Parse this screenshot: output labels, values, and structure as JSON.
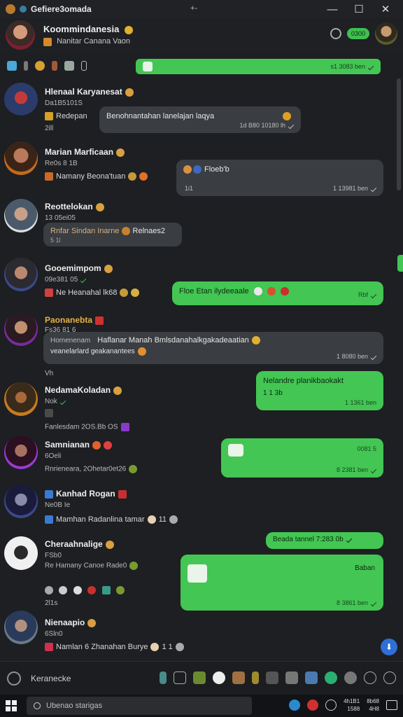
{
  "window": {
    "title": "Gefiere3omada",
    "center_glyph": "+-",
    "minimize": "—",
    "maximize": "☐",
    "close": "✕"
  },
  "header": {
    "name": "Koommindanesia",
    "subtitle": "Nanitar Canana Vaon",
    "pill": "0300"
  },
  "toolbar": {
    "banner_meta": "s1 3083 ben"
  },
  "messages": [
    {
      "name": "Hlenaal Karyanesat",
      "line1": "Da1B5101S",
      "line2": "Redepan",
      "line3": "2ill",
      "bubble": "Benohnantahan lanelajan laqya",
      "meta": "1d B80 10180 lh",
      "kind": "grey"
    },
    {
      "name": "Marian Marficaan",
      "line1": "Re0s 8 1B",
      "line2": "Namany Beona'tuan",
      "bubble": "Floeb'b",
      "meta": "1 13981 ben",
      "kind": "grey-right",
      "bubble_meta_left": "1i1"
    },
    {
      "name": "Reottelokan",
      "line1": "13 05ei05",
      "bubble": "Rnfar Sindan Inarne",
      "bubble_extra": "Relnaes2",
      "bubble_sub": "5 1l",
      "kind": "grey-left"
    },
    {
      "name": "Gooemimpom",
      "line1": "09e381 05",
      "line2": "Ne Heanahal lk68",
      "bubble": "Floe Etan ilydeeaale",
      "meta": "Rbf",
      "kind": "green"
    },
    {
      "name": "Paonanebta",
      "line1": "Fs36 81 6",
      "line2": "Homenenam",
      "bubble": "Haflanar Manah Bmlsdanahalkgakadeaatian",
      "bubble_sub": "veanelarlard geakanantees",
      "meta": "1 8080 ben",
      "line3": "Vh",
      "kind": "grey-wide"
    },
    {
      "name": "NedamaKoladan",
      "line1": "Nok",
      "line2": "Fanlesdam 2OS.Bb OS",
      "bubble": "Nelandre planikbaokakt",
      "bubble_sub": "1 1 3b",
      "meta": "1 1361 ben",
      "kind": "green"
    },
    {
      "name": "Samnianan",
      "line1": "6Oeli",
      "line2": "Rnrieneara, 2Ohetar0et26",
      "meta": "8 2381 ben",
      "meta_top": "0081 5",
      "kind": "green-media"
    },
    {
      "name": "Kanhad Rogan",
      "line1": "Ne0B Ie",
      "line2": "Mamhan Radanlina tamar",
      "line2_extra": "11",
      "kind": "none"
    },
    {
      "name": "Cheraahnalige",
      "line1": "FSb0",
      "line2": "Re Hamany Canoe Rade0",
      "line3": "2l1s",
      "bubble": "Beada tannel 7:283 0b",
      "meta": "8 3861 ben",
      "media_label": "Baban",
      "kind": "green-stack"
    },
    {
      "name": "Nienaapio",
      "line1": "6Sln0",
      "line2": "Namlan 6 Zhanahan Burye",
      "line2_extra": "1 1",
      "kind": "none"
    }
  ],
  "composer": {
    "placeholder": "Keranecke"
  },
  "taskbar": {
    "search": "Ubenao starigas",
    "time": "4h1B1",
    "date": "1588",
    "time2": "8b68",
    "date2": "4H8"
  },
  "colors": {
    "accent_green": "#43c653",
    "bubble_grey": "#3a3d41",
    "background": "#1d1f22"
  }
}
